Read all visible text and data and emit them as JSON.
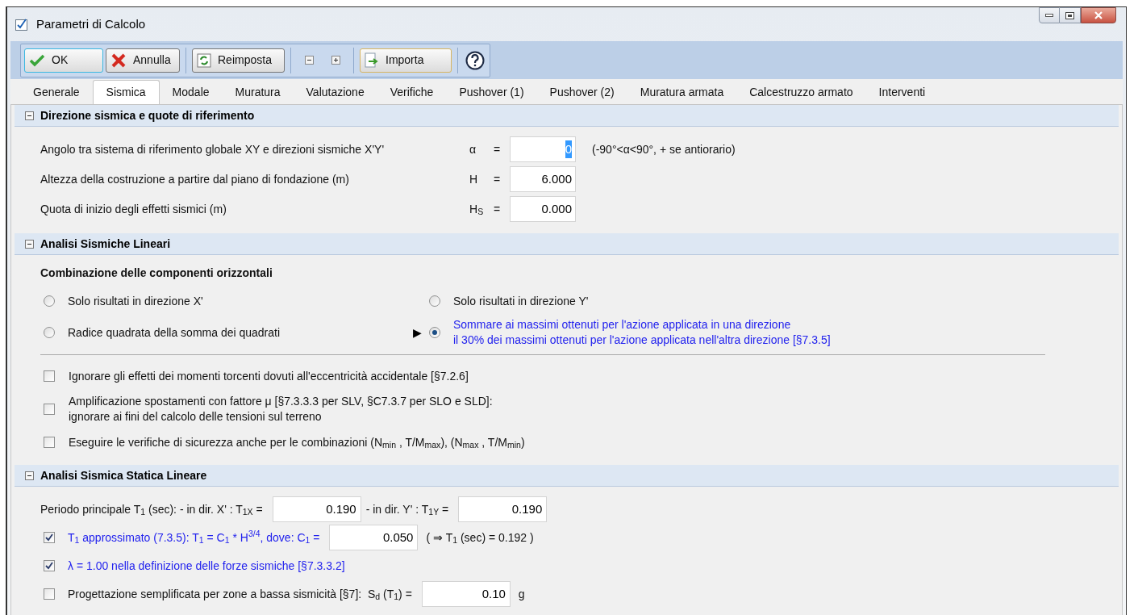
{
  "window": {
    "title": "Parametri di Calcolo"
  },
  "toolbar": [
    {
      "kind": "ok",
      "label": "OK"
    },
    {
      "kind": "cancel",
      "label": "Annulla"
    },
    {
      "kind": "separator"
    },
    {
      "kind": "reset",
      "label": "Reimposta"
    },
    {
      "kind": "separator"
    },
    {
      "kind": "collapse"
    },
    {
      "kind": "expand"
    },
    {
      "kind": "separator"
    },
    {
      "kind": "import",
      "label": "Importa"
    },
    {
      "kind": "separator"
    },
    {
      "kind": "help"
    }
  ],
  "tabs": [
    {
      "label": "Generale",
      "selected": false
    },
    {
      "label": "Sismica",
      "selected": true
    },
    {
      "label": "Modale",
      "selected": false
    },
    {
      "label": "Muratura",
      "selected": false
    },
    {
      "label": "Valutazione",
      "selected": false
    },
    {
      "label": "Verifiche",
      "selected": false
    },
    {
      "label": "Pushover (1)",
      "selected": false
    },
    {
      "label": "Pushover (2)",
      "selected": false
    },
    {
      "label": "Muratura armata",
      "selected": false
    },
    {
      "label": "Calcestruzzo armato",
      "selected": false
    },
    {
      "label": "Interventi",
      "selected": false
    }
  ],
  "sections": [
    {
      "kind": "params",
      "title": "Direzione sismica e quote di riferimento",
      "expanded": true,
      "rows": [
        {
          "label": "Angolo tra sistema di riferimento globale XY e direzioni sismiche X'Y'",
          "symbol": "α",
          "sign": "=",
          "value": "0",
          "highlighted": true,
          "note": "(-90°<α<90°, + se antiorario)"
        },
        {
          "label": "Altezza della costruzione a partire dal piano di fondazione (m)",
          "symbol": "H",
          "sign": "=",
          "value": "6.000",
          "highlighted": false
        },
        {
          "label": "Quota di inizio degli effetti sismici (m)",
          "symbol": "H$_{S}$",
          "sign": "=",
          "value": "0.000",
          "highlighted": false
        }
      ]
    },
    {
      "kind": "options",
      "title": "Analisi Sismiche Lineari",
      "expanded": true,
      "subtitle": "Combinazione delle componenti orizzontali",
      "radios": [
        {
          "label": "Solo risultati in direzione X'",
          "selected": false
        },
        {
          "label": "Solo risultati in direzione Y'",
          "selected": false
        },
        {
          "label": "Radice quadrata della somma dei quadrati",
          "selected": false
        },
        {
          "label": "Sommare ai massimi ottenuti per l'azione applicata in una direzione\nil 30% dei massimi ottenuti per l'azione applicata nell'altra direzione [§7.3.5]",
          "selected": true,
          "marker": "▶"
        }
      ],
      "checks": [
        {
          "label": "Ignorare gli effetti dei momenti torcenti dovuti all'eccentricità accidentale [§7.2.6]",
          "checked": false
        },
        {
          "label": "Amplificazione spostamenti con fattore μ [§7.3.3.3 per SLV, §C7.3.7 per SLO e SLD]:\nignorare ai fini del calcolo delle tensioni sul terreno",
          "checked": false
        },
        {
          "label": "Eseguire le verifiche di sicurezza anche per le combinazioni (N$_{min}$ , T/M$_{max}$), (N$_{max}$ , T/M$_{min}$)",
          "checked": false
        }
      ]
    },
    {
      "kind": "rows",
      "title": "Analisi Sismica Statica Lineare",
      "expanded": true,
      "rows": [
        {
          "kind": "plain",
          "parts": [
            {
              "kind": "text",
              "text": "Periodo principale T$_{1}$ (sec): - in dir. X' : T$_{1X}$ ="
            },
            {
              "kind": "field",
              "value": "0.190"
            },
            {
              "kind": "text",
              "text": "- in dir. Y' : T$_{1Y}$ ="
            },
            {
              "kind": "field",
              "value": "0.190"
            }
          ]
        },
        {
          "kind": "check",
          "checked": true,
          "parts": [
            {
              "kind": "text",
              "text": "T$_{1}$ approssimato (7.3.5): T$_{1}$ = C$_{1}$ * H$^{3/4}$, dove: C$_{1}$ ="
            },
            {
              "kind": "field",
              "value": "0.050"
            },
            {
              "kind": "note",
              "text": "( ⇒ T$_{1}$ (sec) = 0.192 )"
            }
          ]
        },
        {
          "kind": "check",
          "checked": true,
          "parts": [
            {
              "kind": "text",
              "text": "λ = 1.00 nella definizione delle forze sismiche [§7.3.3.2]"
            }
          ]
        },
        {
          "kind": "check",
          "checked": false,
          "parts": [
            {
              "kind": "text",
              "text": "Progettazione semplificata per zone a bassa sismicità [§7]:  S$_{d}$ (T$_{1}$) ="
            },
            {
              "kind": "field",
              "value": "0.10"
            },
            {
              "kind": "note",
              "text": "g"
            }
          ]
        }
      ]
    }
  ]
}
